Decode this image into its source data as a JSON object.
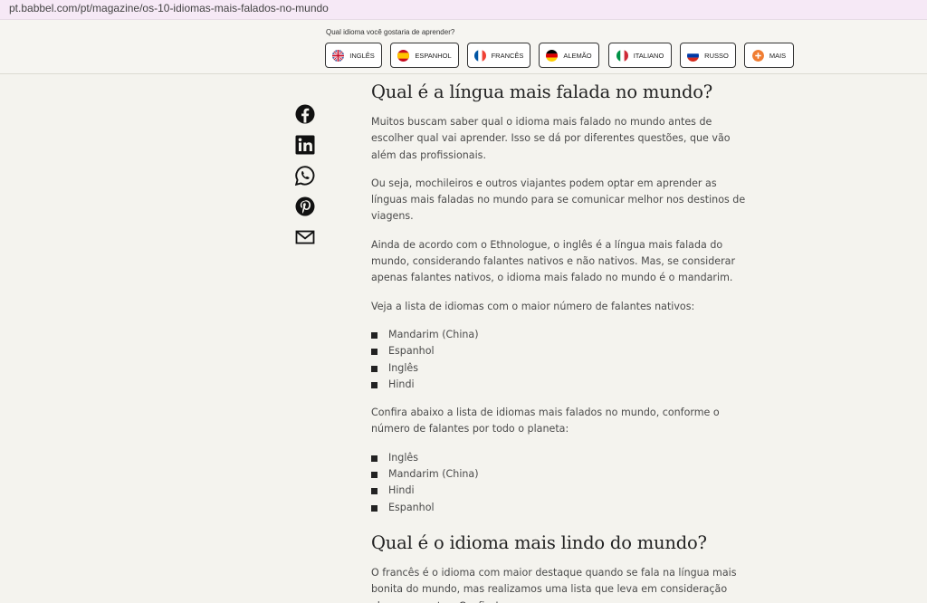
{
  "browser": {
    "url": "pt.babbel.com/pt/magazine/os-10-idiomas-mais-falados-no-mundo"
  },
  "language_bar": {
    "question": "Qual idioma você gostaria de aprender?",
    "languages": [
      {
        "label": "INGLÊS",
        "flag": "uk-flag-icon"
      },
      {
        "label": "ESPANHOL",
        "flag": "spain-flag-icon"
      },
      {
        "label": "FRANCÊS",
        "flag": "france-flag-icon"
      },
      {
        "label": "ALEMÃO",
        "flag": "germany-flag-icon"
      },
      {
        "label": "ITALIANO",
        "flag": "italy-flag-icon"
      },
      {
        "label": "RUSSO",
        "flag": "russia-flag-icon"
      },
      {
        "label": "MAIS",
        "flag": "plus-icon"
      }
    ]
  },
  "share": [
    "facebook-icon",
    "linkedin-icon",
    "whatsapp-icon",
    "pinterest-icon",
    "email-icon"
  ],
  "article": {
    "heading1": "Qual é a língua mais falada no mundo?",
    "p1": "Muitos buscam saber qual o idioma mais falado no mundo antes de escolher qual vai aprender. Isso se dá por diferentes questões, que vão além das profissionais.",
    "p2": "Ou seja, mochileiros e outros viajantes podem optar em aprender as línguas mais faladas no mundo para se comunicar melhor nos destinos de viagens.",
    "p3": "Ainda de acordo com o Ethnologue, o inglês é a língua mais falada do mundo, considerando falantes nativos e não nativos. Mas, se considerar apenas falantes nativos, o idioma mais falado no mundo é o mandarim.",
    "p4": "Veja a lista de idiomas com o maior número de falantes nativos:",
    "list1": [
      "Mandarim (China)",
      "Espanhol",
      "Inglês",
      "Hindi"
    ],
    "p5": "Confira abaixo a lista de idiomas mais falados no mundo, conforme o número de falantes por todo o planeta:",
    "list2": [
      "Inglês",
      "Mandarim (China)",
      "Hindi",
      "Espanhol"
    ],
    "heading2": "Qual é o idioma mais lindo do mundo?",
    "p6": "O francês é o idioma com maior destaque quando se fala na língua mais bonita do mundo, mas realizamos uma lista que leva em consideração alguns aspectos. Confira!"
  }
}
